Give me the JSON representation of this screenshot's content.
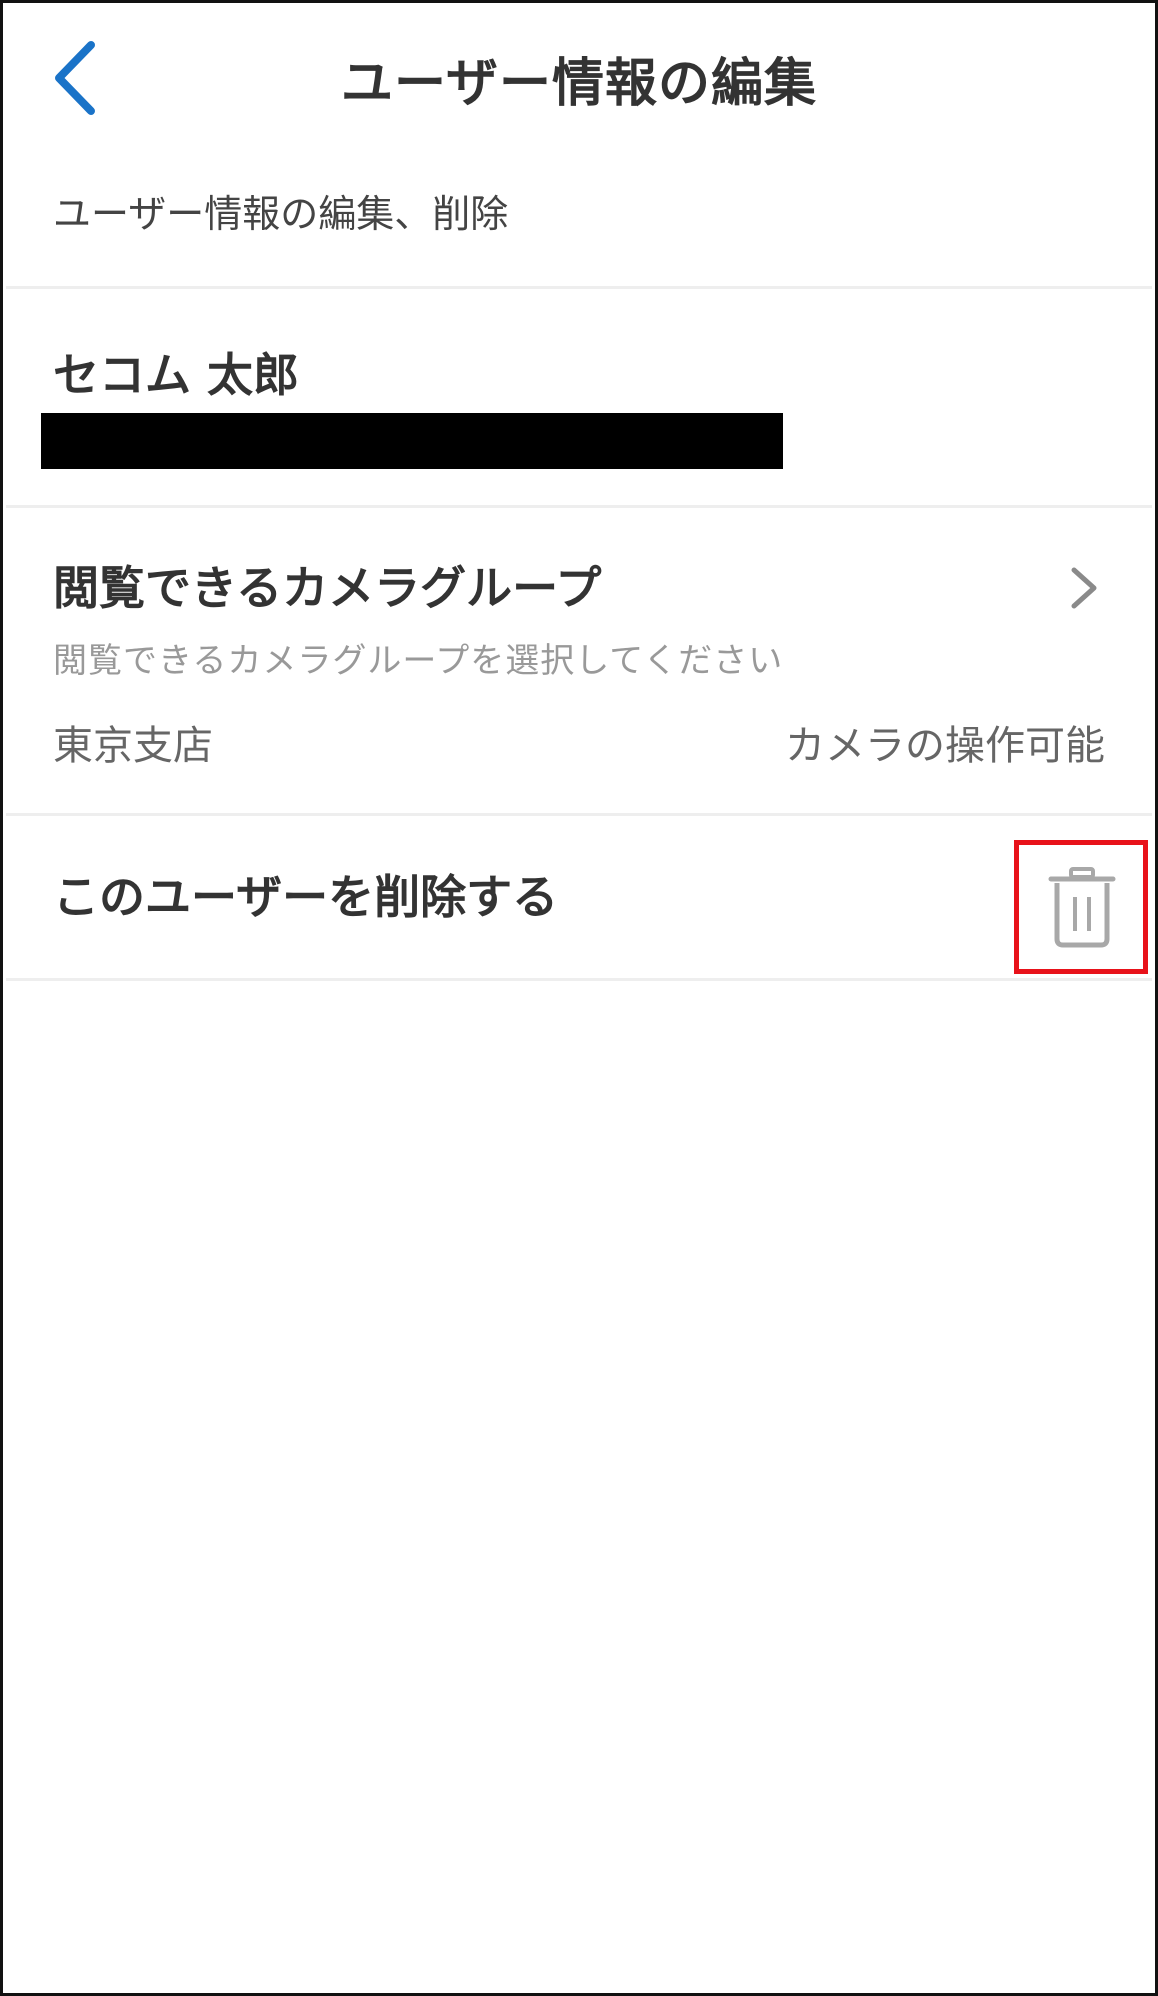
{
  "nav": {
    "title": "ユーザー情報の編集",
    "back_icon": "chevron-left-icon",
    "accent_color": "#1a73c8"
  },
  "subtitle": "ユーザー情報の編集、削除",
  "user": {
    "name": "セコム 太郎"
  },
  "camera_group": {
    "title": "閲覧できるカメラグループ",
    "hint": "閲覧できるカメラグループを選択してください",
    "group_name": "東京支店",
    "permission": "カメラの操作可能",
    "chevron_icon": "chevron-right-icon"
  },
  "delete": {
    "label": "このユーザーを削除する",
    "icon": "trash-icon",
    "highlight_color": "#e8121a"
  }
}
